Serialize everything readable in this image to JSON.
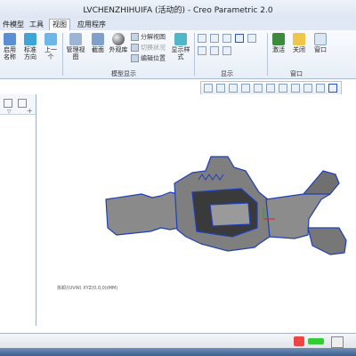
{
  "window": {
    "title": "LVCHENZHIHUIFA (活动的) - Creo Parametric 2.0"
  },
  "tabs": [
    "件模型",
    "工具",
    "视图",
    "应用程序"
  ],
  "active_tab": "视图",
  "ribbon": {
    "buttons": [
      {
        "label": "启用名称",
        "icon": "naming-icon"
      },
      {
        "label": "标准方向",
        "icon": "standard-orientation-icon"
      },
      {
        "label": "上一个",
        "icon": "previous-view-icon"
      },
      {
        "label": "管理视图",
        "icon": "manage-views-icon"
      },
      {
        "label": "截面",
        "icon": "section-icon"
      },
      {
        "label": "外观库",
        "icon": "appearance-gallery-icon"
      },
      {
        "label": "显示样式",
        "icon": "display-style-icon"
      },
      {
        "label": "激活",
        "icon": "activate-icon"
      },
      {
        "label": "关闭",
        "icon": "close-icon"
      },
      {
        "label": "窗口",
        "icon": "window-icon"
      }
    ],
    "small_buttons": [
      "分解视图",
      "切换状况",
      "编辑位置"
    ],
    "groups": [
      "模型显示",
      "显示",
      "窗口"
    ]
  },
  "canvas": {
    "coordinate_text": "拆卸/(UVW) XYZ(0,0,0)(MM)"
  },
  "colors": {
    "accent": "#2b55c9",
    "part": "#8a8a8a",
    "edge": "#1f3fb8"
  }
}
